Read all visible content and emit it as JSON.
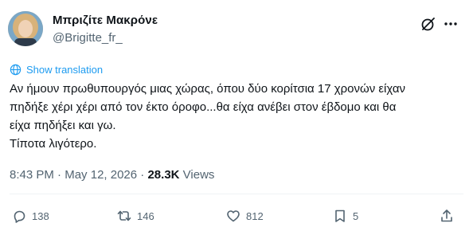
{
  "author": {
    "display_name": "Μπριζίτε Μακρόνε",
    "handle": "@Brigitte_fr_"
  },
  "translate": {
    "label": "Show translation",
    "icon": "globe-icon"
  },
  "tweet": {
    "lines": [
      "Αν ήμουν πρωθυπουργός μιας χώρας, όπου δύο κορίτσια 17 χρονών είχαν",
      "πηδήξε χέρι χέρι από τον έκτο όροφο...θα είχα ανέβει στον έβδομο και θα",
      "είχα πηδήξει και γω.",
      "Τίποτα λιγότερο."
    ]
  },
  "meta": {
    "time": "8:43 PM",
    "separator": " · ",
    "date": "May 12, 2026",
    "views_count": "28.3K",
    "views_label": " Views"
  },
  "actions": {
    "reply": {
      "count": "138",
      "icon": "reply-icon"
    },
    "retweet": {
      "count": "146",
      "icon": "retweet-icon"
    },
    "like": {
      "count": "812",
      "icon": "heart-icon"
    },
    "bookmark": {
      "count": "5",
      "icon": "bookmark-icon"
    },
    "share": {
      "icon": "share-icon"
    }
  },
  "colors": {
    "link": "#1d9bf0",
    "secondary_text": "#536471",
    "primary_text": "#0f1419"
  }
}
